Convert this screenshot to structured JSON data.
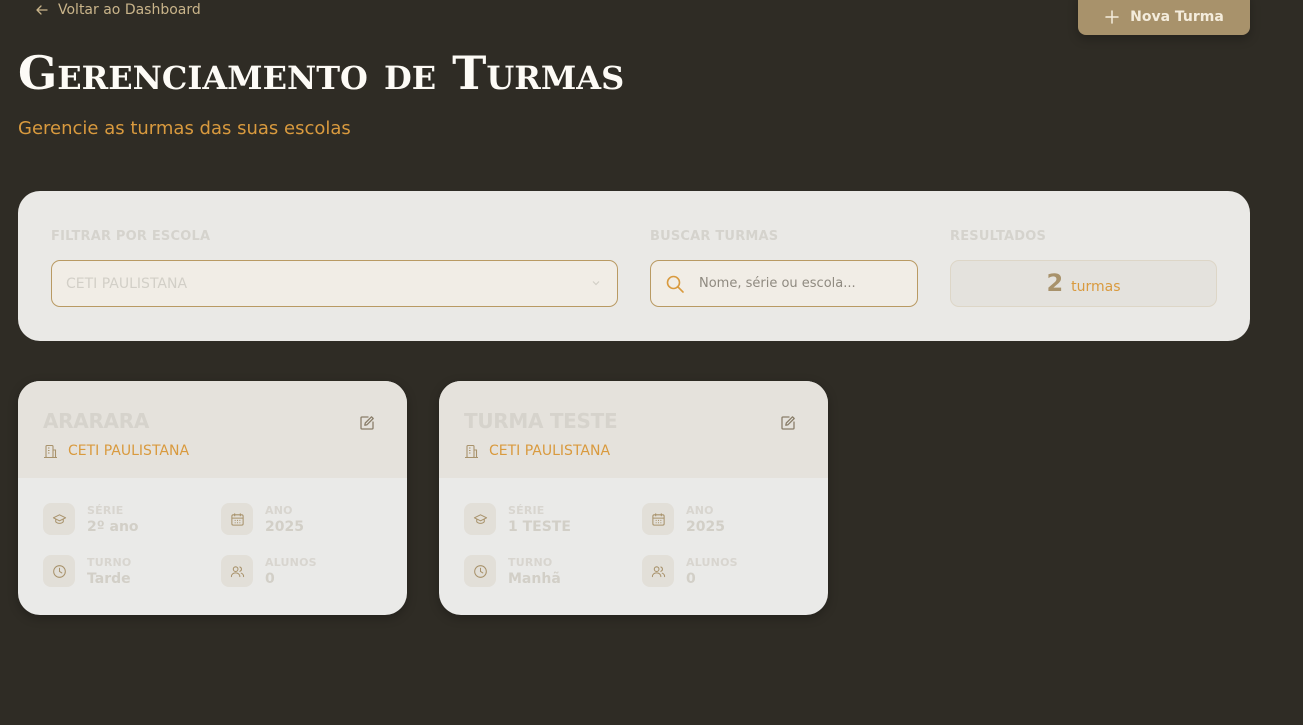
{
  "nav": {
    "back_label": "Voltar ao Dashboard"
  },
  "header": {
    "new_button_label": "Nova Turma",
    "title": "Gerenciamento de Turmas",
    "subtitle": "Gerencie as turmas das suas escolas"
  },
  "filters": {
    "school_label": "FILTRAR POR ESCOLA",
    "school_selected": "CETI PAULISTANA",
    "search_label": "BUSCAR TURMAS",
    "search_placeholder": "Nome, série ou escola...",
    "search_value": "",
    "results_label": "RESULTADOS",
    "results_count": "2",
    "results_unit": "turmas"
  },
  "labels": {
    "serie": "SÉRIE",
    "ano": "ANO",
    "turno": "TURNO",
    "alunos": "ALUNOS"
  },
  "cards": [
    {
      "name": "ARARARA",
      "school": "CETI PAULISTANA",
      "serie": "2º ano",
      "ano": "2025",
      "turno": "Tarde",
      "alunos": "0"
    },
    {
      "name": "TURMA TESTE",
      "school": "CETI PAULISTANA",
      "serie": "1 TESTE",
      "ano": "2025",
      "turno": "Manhã",
      "alunos": "0"
    }
  ],
  "colors": {
    "background": "#2f2c25",
    "accent": "#a8926b",
    "orange": "#d99a3e"
  }
}
